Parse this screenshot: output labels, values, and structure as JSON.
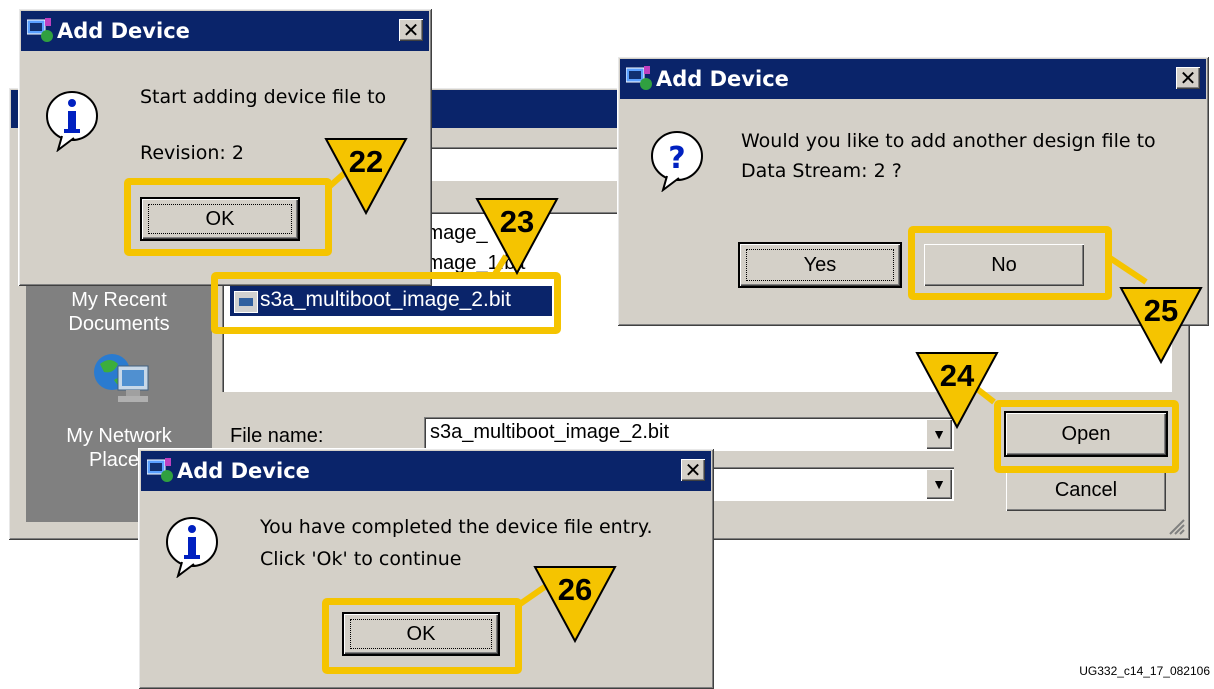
{
  "dialog_title": "Add Device",
  "open_dialog": {
    "places": {
      "recent_documents": "My Recent\nDocuments",
      "network_places": "My Network\nPlaces"
    },
    "files": [
      "image_",
      "image_1.bit",
      "s3a_multiboot_image_2.bit"
    ],
    "file_name_label": "File name:",
    "file_name_value": "s3a_multiboot_image_2.bit",
    "open_label": "Open",
    "cancel_label": "Cancel"
  },
  "dialog_start": {
    "message": "Start adding device file to",
    "revision": "Revision: 2",
    "ok_label": "OK"
  },
  "dialog_another": {
    "message_line1": "Would you like to add another design file to",
    "message_line2": "Data Stream: 2 ?",
    "yes_label": "Yes",
    "no_label": "No"
  },
  "dialog_complete": {
    "message_line1": "You have completed the device file entry.",
    "message_line2": "Click 'Ok' to continue",
    "ok_label": "OK"
  },
  "callouts": {
    "c22": "22",
    "c23": "23",
    "c24": "24",
    "c25": "25",
    "c26": "26"
  },
  "figure_id": "UG332_c14_17_082106",
  "colors": {
    "titlebar": "#0a246a",
    "callout_yellow": "#f5c400",
    "selection": "#0a246a",
    "dialog_face": "#d4d0c8"
  },
  "icons": [
    "app-icon",
    "info-icon",
    "question-icon",
    "close-icon",
    "bit-file-icon",
    "recent-documents-icon",
    "network-places-icon",
    "dropdown-arrow-icon",
    "resize-grip-icon"
  ]
}
